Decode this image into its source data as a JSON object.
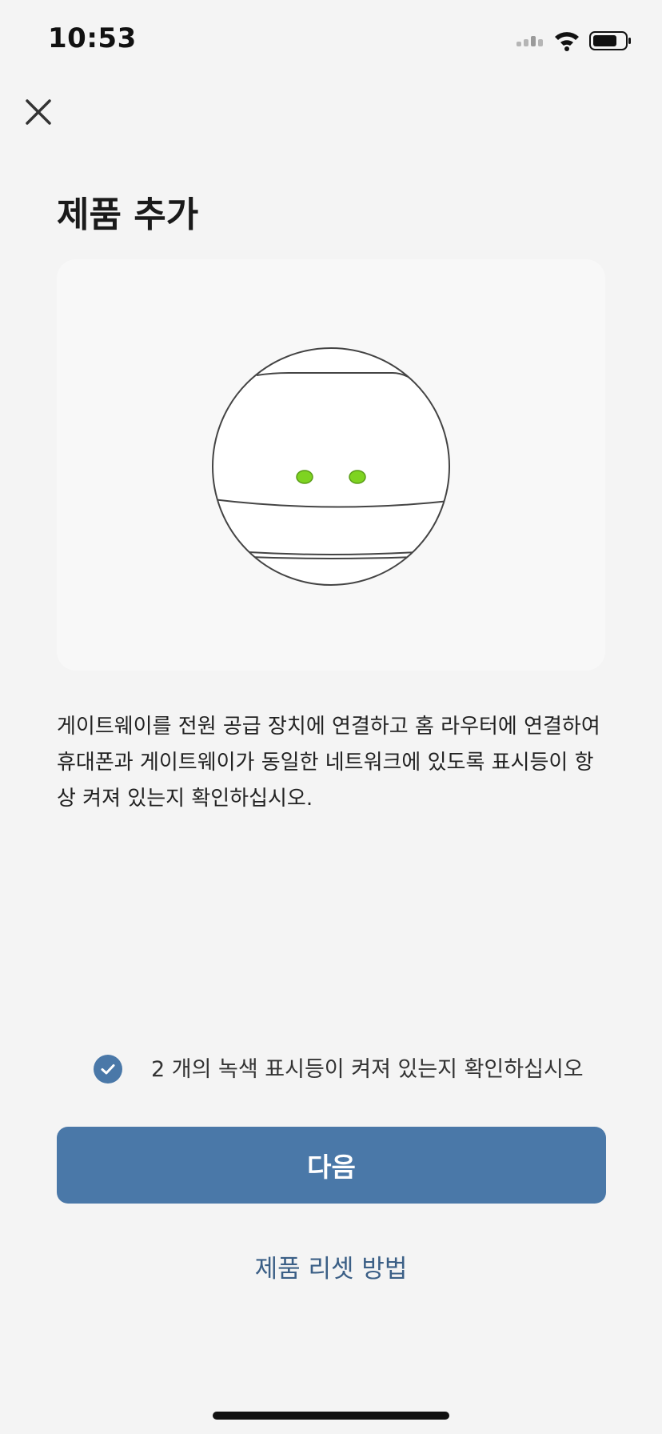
{
  "status_bar": {
    "time": "10:53"
  },
  "header": {
    "close_icon": "close-icon"
  },
  "title": "제품 추가",
  "illustration": {
    "icon": "gateway-device-illustration",
    "led_color": "#7ed321",
    "led_count": 2
  },
  "instruction": "게이트웨이를 전원 공급 장치에 연결하고 홈 라우터에 연결하여 휴대폰과 게이트웨이가 동일한 네트워크에 있도록 표시등이 항상 켜져 있는지 확인하십시오.",
  "confirmation": {
    "checked": true,
    "label": "2 개의 녹색 표시등이 켜져 있는지 확인하십시오"
  },
  "buttons": {
    "next_label": "다음"
  },
  "links": {
    "reset_label": "제품 리셋 방법"
  },
  "colors": {
    "accent": "#4a78a8",
    "link": "#3b5f86",
    "background": "#f4f4f4"
  }
}
